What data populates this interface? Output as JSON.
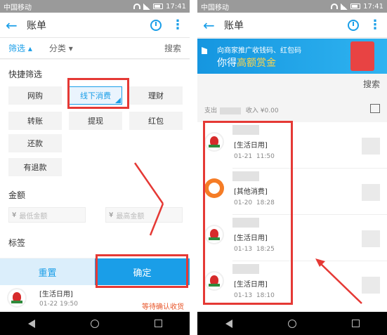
{
  "left": {
    "status": {
      "carrier": "中国移动",
      "badge": "5",
      "time": "17:41"
    },
    "appbar": {
      "title": "账单"
    },
    "filterbar": {
      "filter": "筛选",
      "category": "分类",
      "search": "搜索"
    },
    "quick_filter": {
      "heading": "快捷筛选",
      "chips": [
        "网购",
        "线下消费",
        "理财",
        "转账",
        "提现",
        "红包",
        "还款",
        "有退款"
      ],
      "selected": "线下消费"
    },
    "amount": {
      "heading": "金额",
      "currency": "¥",
      "min_placeholder": "最低金额",
      "max_placeholder": "最高金额"
    },
    "tags": {
      "heading": "标签"
    },
    "buttons": {
      "reset": "重置",
      "confirm": "确定"
    },
    "peek": {
      "category": "[生活日用]",
      "date": "01-22",
      "time": "19:50",
      "status": "等待确认收货"
    }
  },
  "right": {
    "status": {
      "carrier": "中国移动",
      "badge": "5",
      "time": "17:41"
    },
    "appbar": {
      "title": "账单"
    },
    "banner": {
      "line1": "向商家推广收钱码、红包码",
      "line2_prefix": "你得",
      "line2_highlight": "高额赏金"
    },
    "search": "搜索",
    "summary": {
      "expense_label": "支出",
      "income_label": "收入",
      "income_value": "¥0.00"
    },
    "items": [
      {
        "icon": "store",
        "category": "[生活日用]",
        "date": "01-21",
        "time": "11:50"
      },
      {
        "icon": "orange",
        "category": "[其他消费]",
        "date": "01-20",
        "time": "18:28"
      },
      {
        "icon": "store",
        "category": "[生活日用]",
        "date": "01-13",
        "time": "18:25"
      },
      {
        "icon": "store",
        "category": "[生活日用]",
        "date": "01-13",
        "time": "18:10"
      }
    ]
  },
  "colors": {
    "accent": "#1a9ee8",
    "highlight": "#e53935",
    "pending": "#e8562a"
  }
}
